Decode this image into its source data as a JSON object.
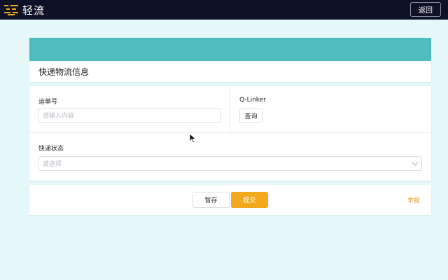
{
  "app": {
    "name": "轻流",
    "logo_icon": "qingflow-logo-icon",
    "back_label": "返回"
  },
  "colors": {
    "topbar": "#0f1126",
    "page_bg": "#e6f7f7",
    "header_band": "#4fbcbd",
    "accent": "#f2a81d",
    "logo_accent": "#f2a81d"
  },
  "header": {
    "title": "快递物流信息"
  },
  "form": {
    "tracking": {
      "label": "运单号",
      "value": "",
      "placeholder": "请输入内容"
    },
    "linker": {
      "label": "Q-Linker",
      "button_label": "查询"
    },
    "status": {
      "label": "快递状态",
      "placeholder": "请选择",
      "icon": "chevron-down-icon"
    }
  },
  "actions": {
    "save_label": "暂存",
    "submit_label": "提交",
    "report_label": "举报"
  }
}
